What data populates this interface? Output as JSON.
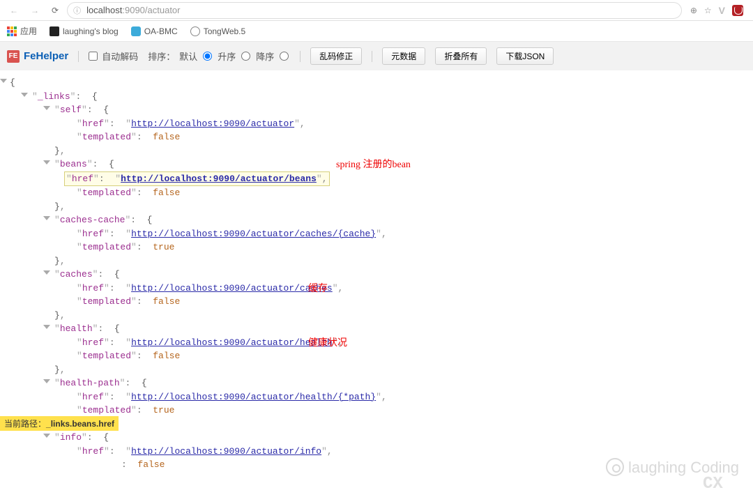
{
  "browser": {
    "url_host": "localhost",
    "url_path": ":9090/actuator",
    "info_icon": "ⓘ"
  },
  "bookmarks": {
    "apps": "应用",
    "b1": "laughing's blog",
    "b2": "OA-BMC",
    "b3": "TongWeb.5"
  },
  "fehelper": {
    "title": "FeHelper",
    "auto": "自动解码",
    "sort_label": "排序：",
    "opt_default": "默认",
    "opt_asc": "升序",
    "opt_desc": "降序",
    "btn_fix": "乱码修正",
    "btn_meta": "元数据",
    "btn_collapse": "折叠所有",
    "btn_download": "下载JSON"
  },
  "json": {
    "root": "{",
    "links_key": "_links",
    "href": "href",
    "templated": "templated",
    "t": "true",
    "f": "false",
    "close": "}",
    "self": {
      "name": "self",
      "url": "http://localhost:9090/actuator"
    },
    "beans": {
      "name": "beans",
      "url": "http://localhost:9090/actuator/beans"
    },
    "cachescache": {
      "name": "caches-cache",
      "url": "http://localhost:9090/actuator/caches/{cache}"
    },
    "caches": {
      "name": "caches",
      "url": "http://localhost:9090/actuator/caches"
    },
    "health": {
      "name": "health",
      "url": "http://localhost:9090/actuator/health"
    },
    "healthpath": {
      "name": "health-path",
      "url": "http://localhost:9090/actuator/health/{*path}"
    },
    "info": {
      "name": "info",
      "url": "http://localhost:9090/actuator/info"
    }
  },
  "annotations": {
    "a1": "spring 注册的bean",
    "a2": "缓存",
    "a3": "健康状况"
  },
  "footer": {
    "path_label": "当前路径：",
    "path_value": "_links.beans.href"
  },
  "watermark": "laughing Coding"
}
